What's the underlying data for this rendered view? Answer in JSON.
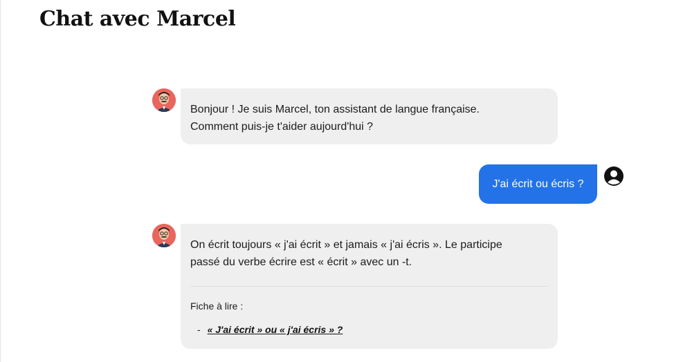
{
  "page": {
    "title": "Chat avec Marcel"
  },
  "messages": {
    "bot1": {
      "text_line1": "Bonjour ! Je suis Marcel, ton assistant de langue française.",
      "text_line2": "Comment puis-je t'aider aujourd'hui ?"
    },
    "user1": {
      "text": "J'ai écrit ou écris ?"
    },
    "bot2": {
      "text_line1": "On écrit toujours « j'ai écrit » et jamais « j'ai écris ». Le participe",
      "text_line2": "passé du verbe écrire est « écrit » avec un -t.",
      "fiche_label": "Fiche à lire :",
      "fiche_bullet": "-",
      "fiche_link": "« J'ai écrit » ou « j'ai écris » ?"
    }
  },
  "colors": {
    "user_bubble": "#2472e8",
    "bot_bubble": "#efefef",
    "avatar_bg": "#e9655d"
  },
  "icons": {
    "bot_avatar": "marcel-avatar",
    "user_avatar": "user-circle-icon"
  }
}
